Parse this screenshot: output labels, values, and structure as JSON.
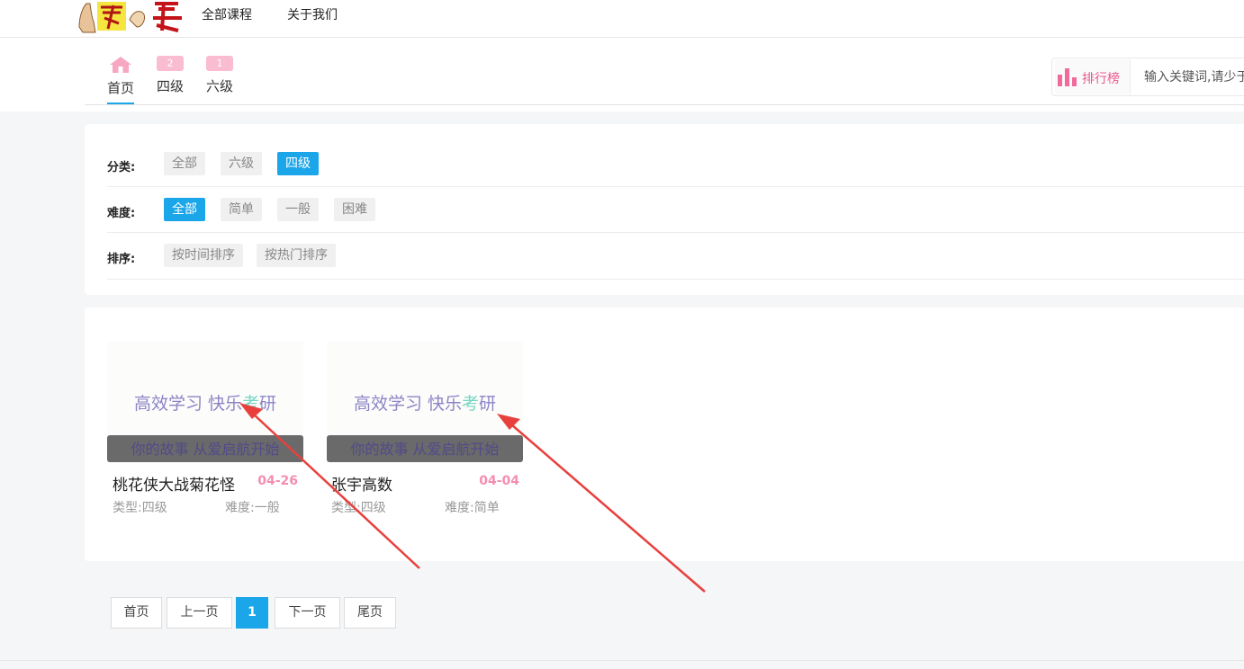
{
  "header": {
    "nav": [
      "全部课程",
      "关于我们"
    ]
  },
  "tabs": [
    {
      "label": "首页",
      "badge": ""
    },
    {
      "label": "四级",
      "badge": "2"
    },
    {
      "label": "六级",
      "badge": "1"
    }
  ],
  "ranking": {
    "label": "排行榜"
  },
  "search": {
    "placeholder": "输入关键词,请少于"
  },
  "filters": {
    "category": {
      "label": "分类:",
      "options": [
        "全部",
        "六级",
        "四级"
      ],
      "selected": "四级"
    },
    "difficulty": {
      "label": "难度:",
      "options": [
        "全部",
        "简单",
        "一般",
        "困难"
      ],
      "selected": "全部"
    },
    "sort": {
      "label": "排序:",
      "options": [
        "按时间排序",
        "按热门排序"
      ]
    }
  },
  "cards": [
    {
      "slogan_a": "高效学习 快乐",
      "slogan_b": "考",
      "slogan_c": "研",
      "caption": "你的故事 从爱启航开始",
      "title": "桃花侠大战菊花怪",
      "date": "04-26",
      "type": "类型:四级",
      "difficulty": "难度:一般"
    },
    {
      "slogan_a": "高效学习 快乐",
      "slogan_b": "考",
      "slogan_c": "研",
      "caption": "你的故事 从爱启航开始",
      "title": "张宇高数",
      "date": "04-04",
      "type": "类型:四级",
      "difficulty": "难度:简单"
    }
  ],
  "pagination": [
    "首页",
    "上一页",
    "1",
    "下一页",
    "尾页"
  ],
  "colors": {
    "accent": "#1ba6ea",
    "pink": "#e8588d",
    "badge": "#f9bcd0",
    "annotation": "#e8403d"
  }
}
